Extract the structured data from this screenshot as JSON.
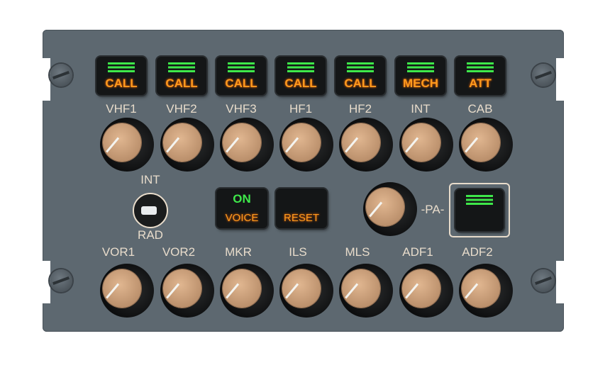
{
  "top_row": [
    {
      "call": "CALL",
      "label": "VHF1"
    },
    {
      "call": "CALL",
      "label": "VHF2"
    },
    {
      "call": "CALL",
      "label": "VHF3"
    },
    {
      "call": "CALL",
      "label": "HF1"
    },
    {
      "call": "CALL",
      "label": "HF2"
    },
    {
      "call": "MECH",
      "label": "INT"
    },
    {
      "call": "ATT",
      "label": "CAB"
    }
  ],
  "bottom_row": [
    "VOR1",
    "VOR2",
    "MKR",
    "ILS",
    "MLS",
    "ADF1",
    "ADF2"
  ],
  "toggle": {
    "top": "INT",
    "bottom": "RAD"
  },
  "voice_button": {
    "on": "ON",
    "label": "VOICE"
  },
  "reset_button": {
    "label": "RESET"
  },
  "pa": {
    "label": "-PA-"
  },
  "colors": {
    "panel": "#5d6870",
    "call_amber": "#ff9a1e",
    "indicator_green": "#3ee84a",
    "label": "#e8dccb"
  }
}
